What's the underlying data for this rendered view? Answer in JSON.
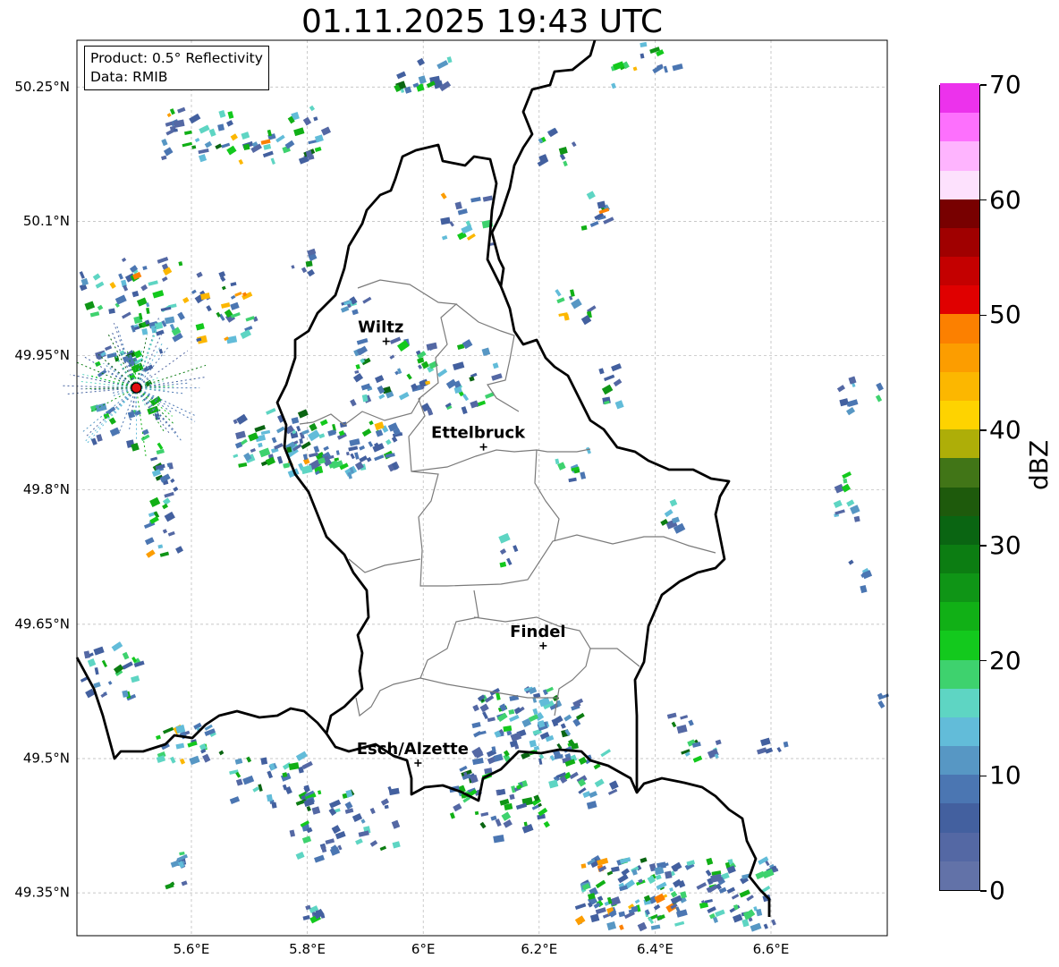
{
  "title": "01.11.2025 19:43 UTC",
  "info_box": {
    "product": "Product: 0.5° Reflectivity",
    "data": "Data: RMIB"
  },
  "axes": {
    "lat_labels": [
      "50.25°N",
      "50.1°N",
      "49.95°N",
      "49.8°N",
      "49.65°N",
      "49.5°N",
      "49.35°N"
    ],
    "lon_labels": [
      "5.6°E",
      "5.8°E",
      "6°E",
      "6.2°E",
      "6.4°E",
      "6.6°E"
    ]
  },
  "cities": [
    {
      "name": "Wiltz",
      "lon": 5.936,
      "lat": 49.966
    },
    {
      "name": "Ettelbruck",
      "lon": 6.104,
      "lat": 49.848
    },
    {
      "name": "Findel",
      "lon": 6.207,
      "lat": 49.626
    },
    {
      "name": "Esch/Alzette",
      "lon": 5.991,
      "lat": 49.495
    }
  ],
  "radar_site": {
    "lon": 5.505,
    "lat": 49.914,
    "color": "#e01010"
  },
  "colorbar": {
    "unit": "dBZ",
    "min": 0,
    "max": 70,
    "tick_labels": [
      "0",
      "10",
      "20",
      "30",
      "40",
      "50",
      "60",
      "70"
    ],
    "colors": [
      "#6272a8",
      "#5468a4",
      "#43609f",
      "#4b76b2",
      "#5797c4",
      "#62bcd9",
      "#5ed5c3",
      "#3ed26e",
      "#13c91d",
      "#11b016",
      "#0f9516",
      "#0c7d12",
      "#0a6512",
      "#1e5a0c",
      "#417517",
      "#aeae08",
      "#fed300",
      "#fcb700",
      "#fc9d00",
      "#fc8000",
      "#e00000",
      "#c40000",
      "#a00000",
      "#780000",
      "#fde1fd",
      "#feb4fe",
      "#fd70fd",
      "#ec32ec"
    ]
  },
  "map_colors": {
    "country_border": "#000000",
    "district_border": "#7a7a7a"
  }
}
